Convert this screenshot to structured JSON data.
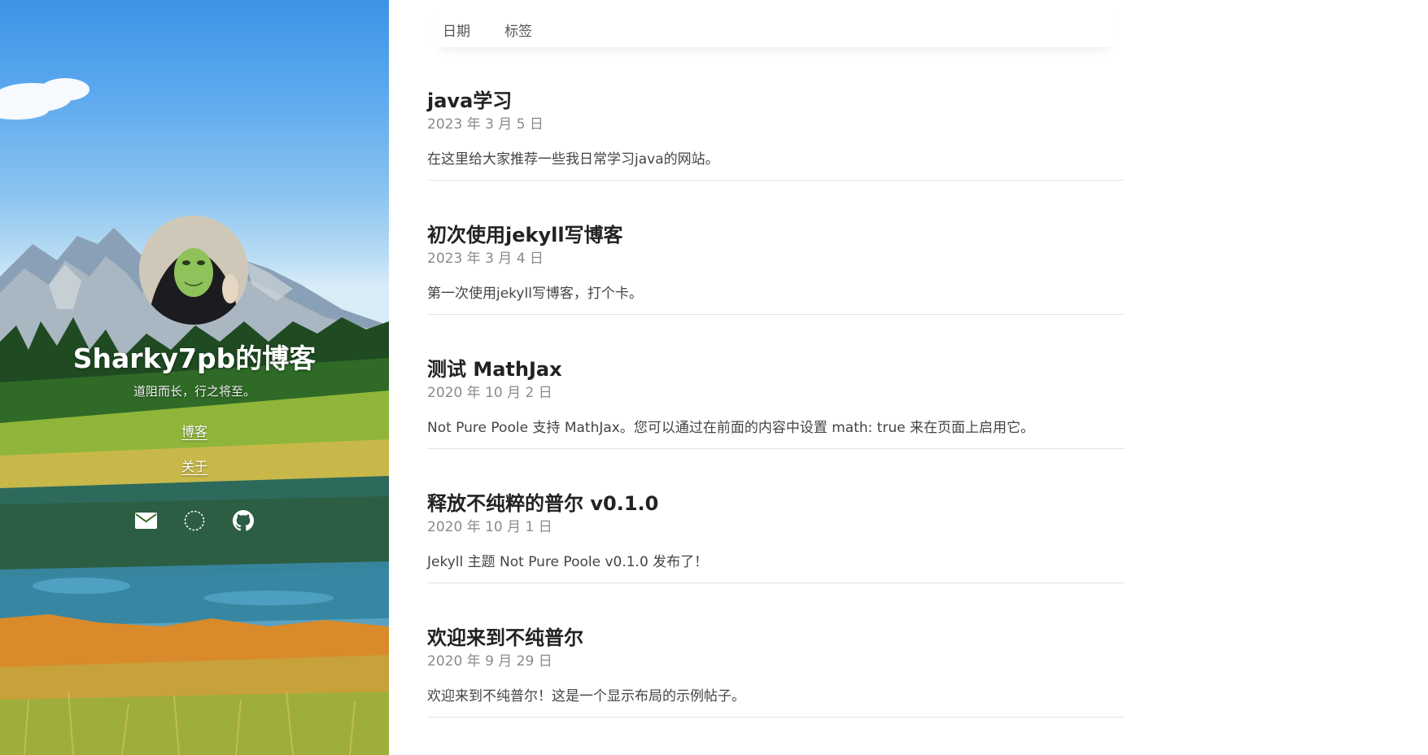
{
  "sidebar": {
    "title": "Sharky7pb的博客",
    "motto": "道阻而长，行之将至。",
    "nav": [
      "博客",
      "关于"
    ],
    "social_icons": [
      "envelope-icon",
      "circle-icon",
      "github-icon"
    ]
  },
  "topnav": {
    "items": [
      "日期",
      "标签"
    ]
  },
  "posts": [
    {
      "title": "java学习",
      "date": "2023 年 3 月 5 日",
      "excerpt": "在这里给大家推荐一些我日常学习java的网站。"
    },
    {
      "title": "初次使用jekyll写博客",
      "date": "2023 年 3 月 4 日",
      "excerpt": "第一次使用jekyll写博客，打个卡。"
    },
    {
      "title": "测试 MathJax",
      "date": "2020 年 10 月 2 日",
      "excerpt": "Not Pure Poole 支持 MathJax。您可以通过在前面的内容中设置 math: true 来在页面上启用它。"
    },
    {
      "title": "释放不纯粹的普尔 v0.1.0",
      "date": "2020 年 10 月 1 日",
      "excerpt": "Jekyll 主题 Not Pure Poole v0.1.0 发布了！"
    },
    {
      "title": "欢迎来到不纯普尔",
      "date": "2020 年 9 月 29 日",
      "excerpt": "欢迎来到不纯普尔！这是一个显示布局的示例帖子。"
    }
  ],
  "colors": {
    "title_text": "#222222",
    "date_text": "#8a8a8a",
    "excerpt_text": "#444444",
    "sky_top": "#3d93e6"
  }
}
